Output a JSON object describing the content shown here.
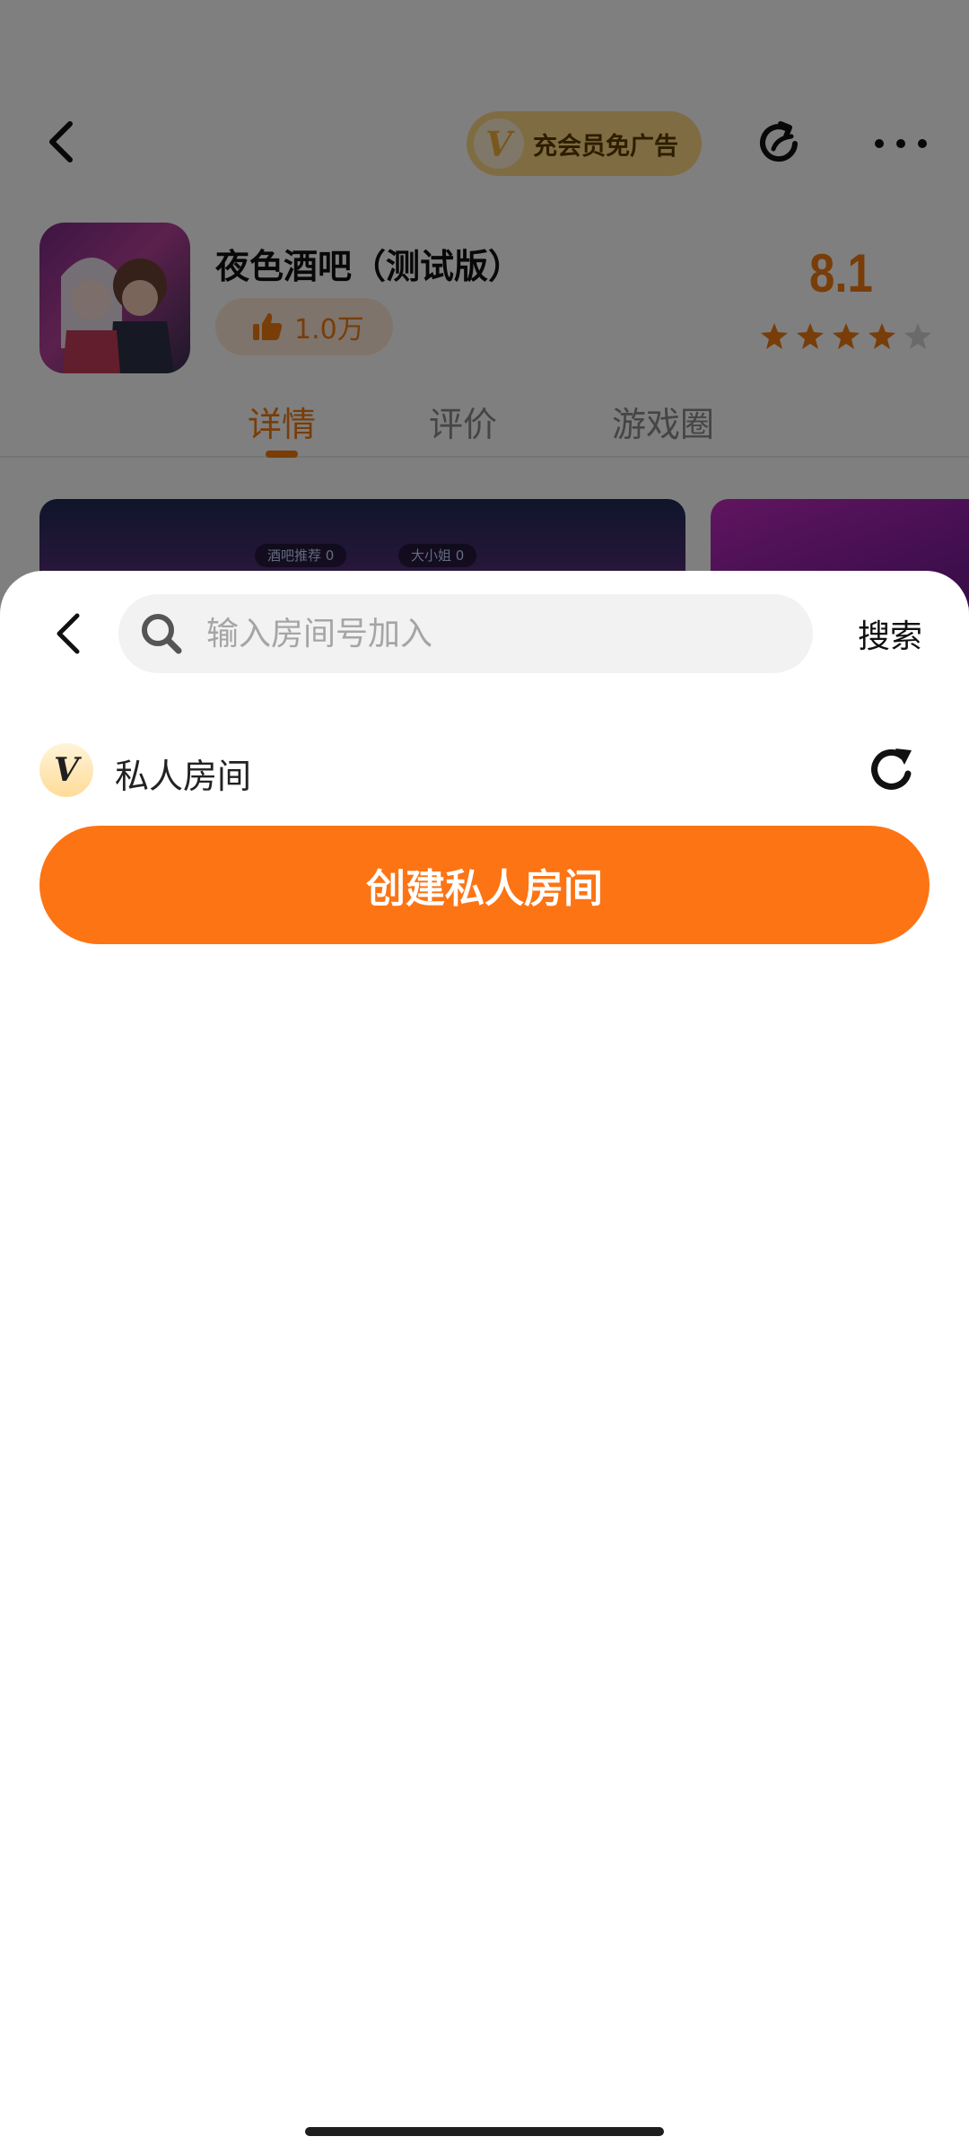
{
  "background": {
    "vip_promo": "充会员免广告",
    "vip_badge": "V",
    "app_title": "夜色酒吧（测试版）",
    "likes": "1.0万",
    "score": "8.1",
    "stars_rating": 4,
    "stars_total": 5,
    "tabs": [
      {
        "label": "详情",
        "active": true
      },
      {
        "label": "评价",
        "active": false
      },
      {
        "label": "游戏圈",
        "active": false
      }
    ],
    "screenshot_chips": [
      "酒吧推荐  0",
      "大小姐  0"
    ]
  },
  "sheet": {
    "search": {
      "placeholder": "输入房间号加入",
      "value": "",
      "button_label": "搜索"
    },
    "private_room": {
      "badge": "V",
      "label": "私人房间"
    },
    "create_button_label": "创建私人房间"
  },
  "colors": {
    "accent": "#fd7414",
    "tab_active": "#f07a12",
    "overlay": "rgba(0,0,0,0.5)"
  },
  "icons": [
    "back-icon",
    "share-icon",
    "more-icon",
    "thumbs-up-icon",
    "star-icon",
    "search-icon",
    "refresh-icon"
  ]
}
